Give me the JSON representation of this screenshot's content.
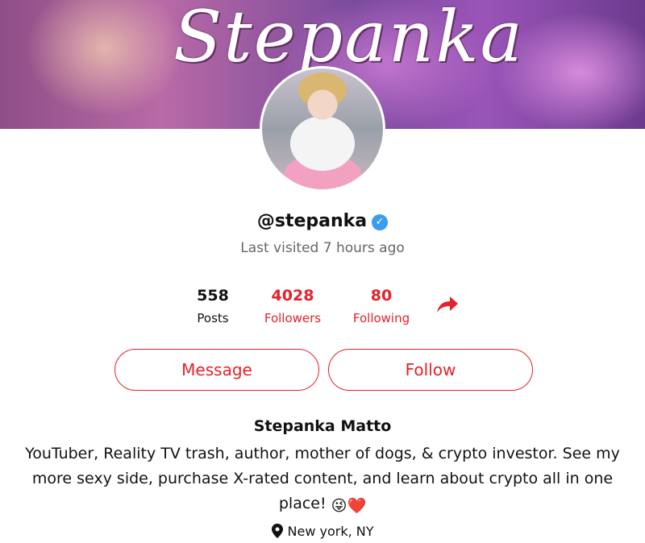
{
  "banner": {
    "title": "Stepanka"
  },
  "profile": {
    "username": "@stepanka",
    "verified_icon": "verified-check-icon",
    "last_visited": "Last visited 7 hours ago"
  },
  "stats": {
    "posts": {
      "value": "558",
      "label": "Posts"
    },
    "followers": {
      "value": "4028",
      "label": "Followers"
    },
    "following": {
      "value": "80",
      "label": "Following"
    },
    "share_icon": "share-arrow-icon"
  },
  "actions": {
    "message_label": "Message",
    "follow_label": "Follow"
  },
  "bio": {
    "name": "Stepanka Matto",
    "text": "YouTuber, Reality TV trash, author, mother of dogs, & crypto investor. See my more sexy side, purchase X-rated content, and learn about crypto all in one place!",
    "emojis": "😜❤️"
  },
  "location": {
    "icon": "map-pin-icon",
    "text": "New york, NY"
  },
  "colors": {
    "accent": "#e3222a",
    "verified": "#3b9cf0",
    "muted_text": "#666666"
  }
}
